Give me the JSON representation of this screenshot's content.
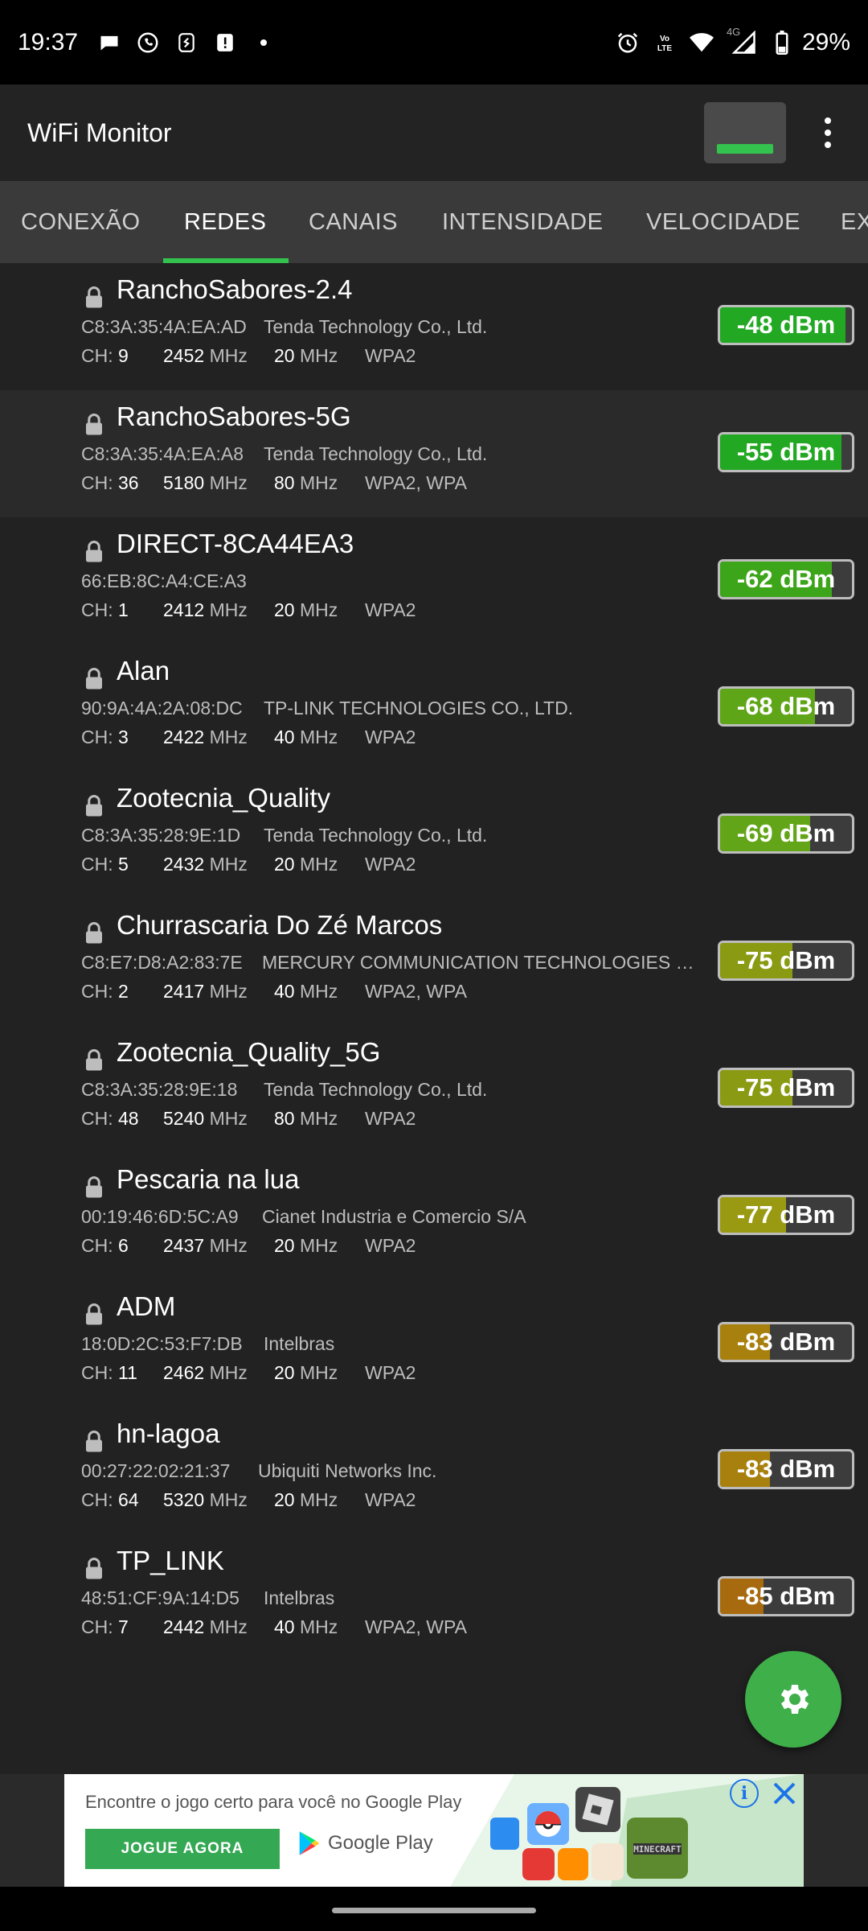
{
  "status_bar": {
    "time": "19:37",
    "battery": "29%",
    "network": "4G",
    "left_icons": [
      "chat-bubble-icon",
      "whatsapp-icon",
      "shazam-icon",
      "alert-icon",
      "dot-icon"
    ],
    "right_icons": [
      "alarm-icon",
      "volte-icon",
      "wifi-icon",
      "signal-icon",
      "battery-icon"
    ]
  },
  "app_bar": {
    "title": "WiFi Monitor"
  },
  "tabs": [
    {
      "label": "CONEXÃO",
      "active": false
    },
    {
      "label": "REDES",
      "active": true
    },
    {
      "label": "CANAIS",
      "active": false
    },
    {
      "label": "INTENSIDADE",
      "active": false
    },
    {
      "label": "VELOCIDADE",
      "active": false
    },
    {
      "label": "EX",
      "active": false
    }
  ],
  "networks": [
    {
      "ssid": "RanchoSabores-2.4",
      "mac": "C8:3A:35:4A:EA:AD",
      "vendor": "Tenda Technology Co., Ltd.",
      "ch_label": "CH:",
      "ch": "9",
      "freq": "2452",
      "freq_unit": "MHz",
      "width": "20",
      "width_unit": "MHz",
      "security": "WPA2",
      "signal": "-48 dBm",
      "level": 0.95,
      "color": "#22a822"
    },
    {
      "ssid": "RanchoSabores-5G",
      "mac": "C8:3A:35:4A:EA:A8",
      "vendor": "Tenda Technology Co., Ltd.",
      "ch_label": "CH:",
      "ch": "36",
      "freq": "5180",
      "freq_unit": "MHz",
      "width": "80",
      "width_unit": "MHz",
      "security": "WPA2, WPA",
      "signal": "-55 dBm",
      "level": 0.92,
      "color": "#22a822"
    },
    {
      "ssid": "DIRECT-8CA44EA3",
      "mac": "66:EB:8C:A4:CE:A3",
      "vendor": "",
      "ch_label": "CH:",
      "ch": "1",
      "freq": "2412",
      "freq_unit": "MHz",
      "width": "20",
      "width_unit": "MHz",
      "security": "WPA2",
      "signal": "-62 dBm",
      "level": 0.85,
      "color": "#3da51a"
    },
    {
      "ssid": "Alan",
      "mac": "90:9A:4A:2A:08:DC",
      "vendor": "TP-LINK TECHNOLOGIES CO., LTD.",
      "ch_label": "CH:",
      "ch": "3",
      "freq": "2422",
      "freq_unit": "MHz",
      "width": "40",
      "width_unit": "MHz",
      "security": "WPA2",
      "signal": "-68 dBm",
      "level": 0.72,
      "color": "#5fa518"
    },
    {
      "ssid": "Zootecnia_Quality",
      "mac": "C8:3A:35:28:9E:1D",
      "vendor": "Tenda Technology Co., Ltd.",
      "ch_label": "CH:",
      "ch": "5",
      "freq": "2432",
      "freq_unit": "MHz",
      "width": "20",
      "width_unit": "MHz",
      "security": "WPA2",
      "signal": "-69 dBm",
      "level": 0.68,
      "color": "#63a518"
    },
    {
      "ssid": "Churrascaria Do Zé Marcos",
      "mac": "C8:E7:D8:A2:83:7E",
      "vendor": "MERCURY COMMUNICATION TECHNOLOGIES CO., LT...",
      "ch_label": "CH:",
      "ch": "2",
      "freq": "2417",
      "freq_unit": "MHz",
      "width": "40",
      "width_unit": "MHz",
      "security": "WPA2, WPA",
      "signal": "-75 dBm",
      "level": 0.55,
      "color": "#8a9a12"
    },
    {
      "ssid": "Zootecnia_Quality_5G",
      "mac": "C8:3A:35:28:9E:18",
      "vendor": "Tenda Technology Co., Ltd.",
      "ch_label": "CH:",
      "ch": "48",
      "freq": "5240",
      "freq_unit": "MHz",
      "width": "80",
      "width_unit": "MHz",
      "security": "WPA2",
      "signal": "-75 dBm",
      "level": 0.55,
      "color": "#8a9a12"
    },
    {
      "ssid": "Pescaria na lua",
      "mac": "00:19:46:6D:5C:A9",
      "vendor": "Cianet Industria e Comercio S/A",
      "ch_label": "CH:",
      "ch": "6",
      "freq": "2437",
      "freq_unit": "MHz",
      "width": "20",
      "width_unit": "MHz",
      "security": "WPA2",
      "signal": "-77 dBm",
      "level": 0.5,
      "color": "#9a9a12"
    },
    {
      "ssid": "ADM",
      "mac": "18:0D:2C:53:F7:DB",
      "vendor": "Intelbras",
      "ch_label": "CH:",
      "ch": "11",
      "freq": "2462",
      "freq_unit": "MHz",
      "width": "20",
      "width_unit": "MHz",
      "security": "WPA2",
      "signal": "-83 dBm",
      "level": 0.38,
      "color": "#a8800e"
    },
    {
      "ssid": "hn-lagoa",
      "mac": "00:27:22:02:21:37",
      "vendor": "Ubiquiti Networks Inc.",
      "ch_label": "CH:",
      "ch": "64",
      "freq": "5320",
      "freq_unit": "MHz",
      "width": "20",
      "width_unit": "MHz",
      "security": "WPA2",
      "signal": "-83 dBm",
      "level": 0.38,
      "color": "#a8800e"
    },
    {
      "ssid": "TP_LINK",
      "mac": "48:51:CF:9A:14:D5",
      "vendor": "Intelbras",
      "ch_label": "CH:",
      "ch": "7",
      "freq": "2442",
      "freq_unit": "MHz",
      "width": "40",
      "width_unit": "MHz",
      "security": "WPA2, WPA",
      "signal": "-85 dBm",
      "level": 0.33,
      "color": "#a86a0e"
    }
  ],
  "fab": {
    "icon": "gear-icon"
  },
  "ad": {
    "text": "Encontre o jogo certo para você no Google Play",
    "cta": "JOGUE AGORA",
    "store": "Google Play"
  },
  "colors": {
    "accent": "#33c24d",
    "fab": "#3faf4a",
    "app_bar": "#232323",
    "tabs_bg": "#3a3a3a",
    "list_bg": "#222222"
  }
}
